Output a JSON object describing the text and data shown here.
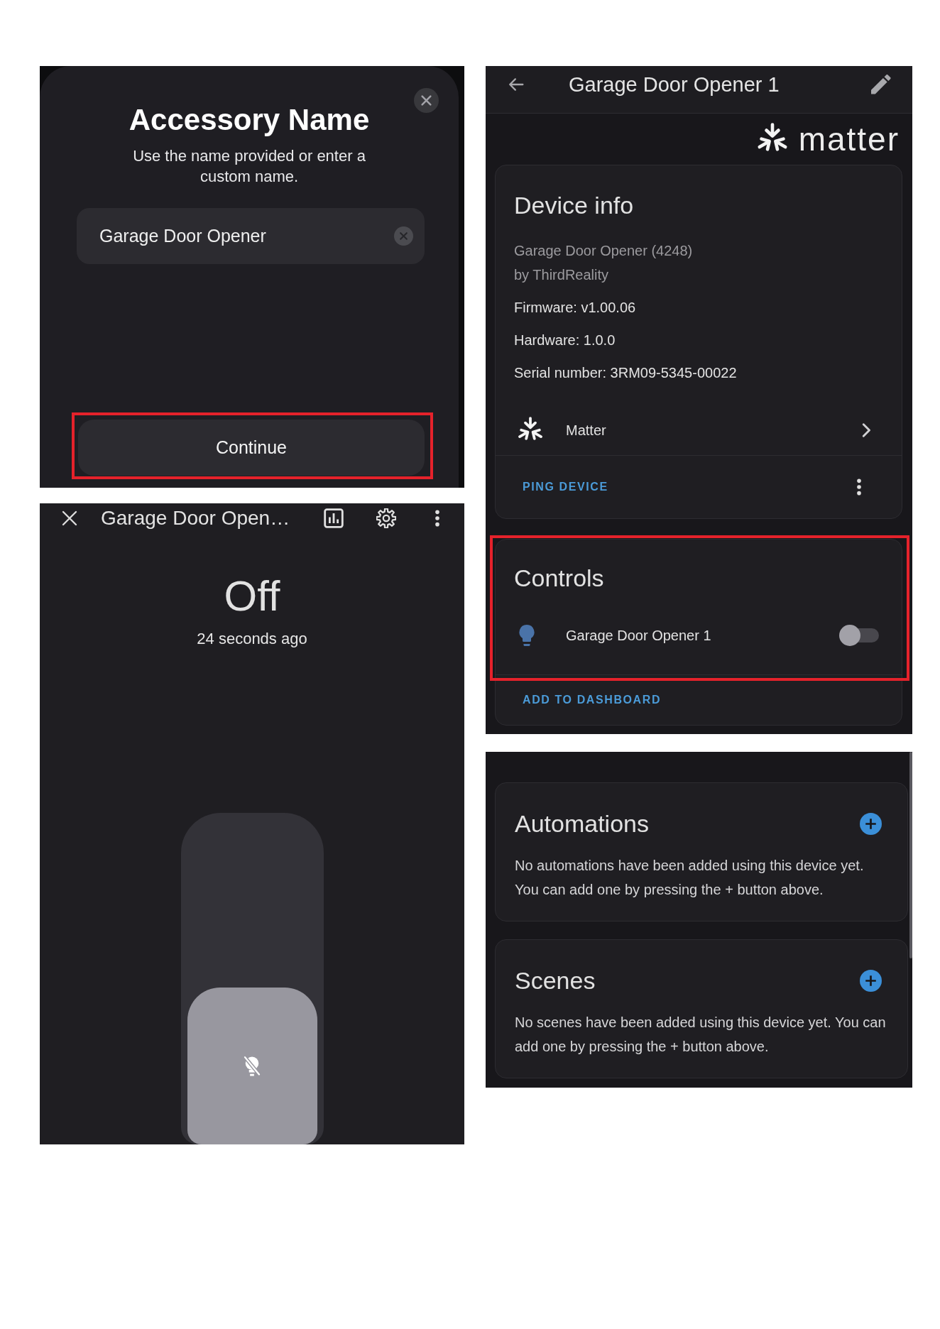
{
  "accessory_name_sheet": {
    "title": "Accessory Name",
    "subtitle": "Use the name provided or enter a custom name.",
    "name_field": {
      "value": "Garage Door Opener"
    },
    "continue_button": {
      "label": "Continue",
      "highlighted": true
    }
  },
  "more_info_dialog": {
    "title": "Garage Door Open…",
    "state": "Off",
    "last_changed": "24 seconds ago",
    "toggle": {
      "on": false
    }
  },
  "device_page": {
    "title": "Garage Door Opener 1",
    "brand": "matter",
    "device_info": {
      "title": "Device info",
      "model": "Garage Door Opener (4248)",
      "manufacturer": "by ThirdReality",
      "details": [
        "Firmware: v1.00.06",
        "Hardware: 1.0.0",
        "Serial number: 3RM09-5345-00022"
      ],
      "integration": "Matter",
      "action": "PING DEVICE"
    },
    "controls": {
      "title": "Controls",
      "highlighted": true,
      "entities": [
        {
          "name": "Garage Door Opener 1",
          "on": false
        }
      ],
      "action": "ADD TO DASHBOARD"
    }
  },
  "related_panel": {
    "cards": [
      {
        "title": "Automations",
        "text": "No automations have been added using this device yet. You can add one by pressing the + button above."
      },
      {
        "title": "Scenes",
        "text": "No scenes have been added using this device yet. You can add one by pressing the + button above."
      }
    ]
  }
}
